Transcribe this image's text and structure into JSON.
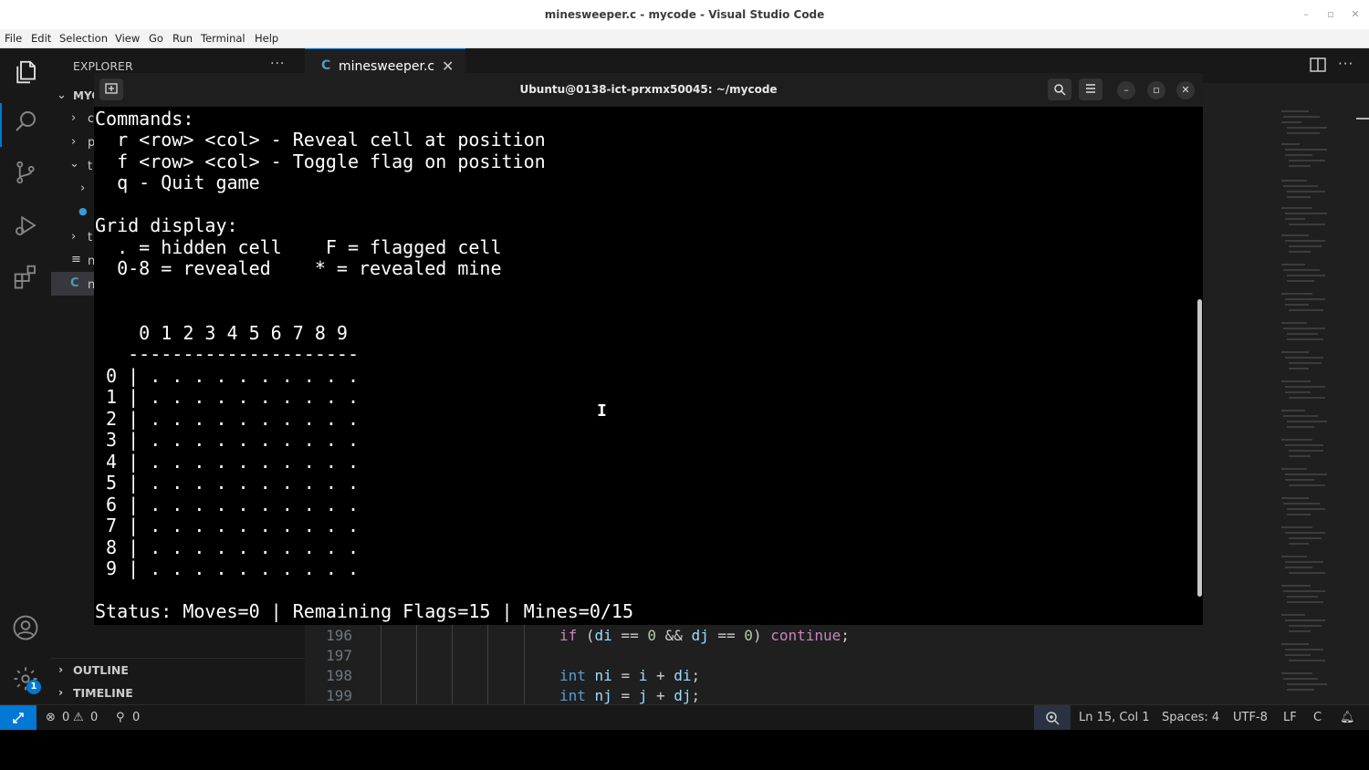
{
  "window": {
    "title": "minesweeper.c - mycode - Visual Studio Code"
  },
  "menu": [
    "File",
    "Edit",
    "Selection",
    "View",
    "Go",
    "Run",
    "Terminal",
    "Help"
  ],
  "sidebar": {
    "title": "EXPLORER",
    "more": "···",
    "folder": "MYC",
    "rows": [
      "c",
      "p",
      "t",
      "",
      "",
      "t",
      "n",
      "n"
    ],
    "outline": "OUTLINE",
    "timeline": "TIMELINE"
  },
  "editor": {
    "tab": {
      "lang": "C",
      "name": "minesweeper.c"
    },
    "lines": [
      {
        "no": "196"
      },
      {
        "no": "197"
      },
      {
        "no": "198"
      },
      {
        "no": "199"
      }
    ]
  },
  "terminal": {
    "title": "Ubuntu@0138-ict-prxmx50045: ~/mycode",
    "lines": [
      "Commands:",
      "  r <row> <col> - Reveal cell at position",
      "  f <row> <col> - Toggle flag on position",
      "  q - Quit game",
      "",
      "Grid display:",
      "  . = hidden cell    F = flagged cell",
      "  0-8 = revealed    * = revealed mine",
      "",
      "",
      "    0 1 2 3 4 5 6 7 8 9",
      "   ---------------------",
      " 0 | . . . . . . . . . .",
      " 1 | . . . . . . . . . .",
      " 2 | . . . . . . . . . .",
      " 3 | . . . . . . . . . .",
      " 4 | . . . . . . . . . .",
      " 5 | . . . . . . . . . .",
      " 6 | . . . . . . . . . .",
      " 7 | . . . . . . . . . .",
      " 8 | . . . . . . . . . .",
      " 9 | . . . . . . . . . .",
      "",
      "Status: Moves=0 | Remaining Flags=15 | Mines=0/15"
    ]
  },
  "statusbar": {
    "errors": "0",
    "warnings": "0",
    "ports": "0",
    "position": "Ln 15, Col 1",
    "spaces": "Spaces: 4",
    "encoding": "UTF-8",
    "eol": "LF",
    "language": "C"
  },
  "settings_badge": "1",
  "colors": {
    "accent": "#0078d4",
    "terminal_bg": "#000000",
    "editor_bg": "#1f1f1f"
  }
}
